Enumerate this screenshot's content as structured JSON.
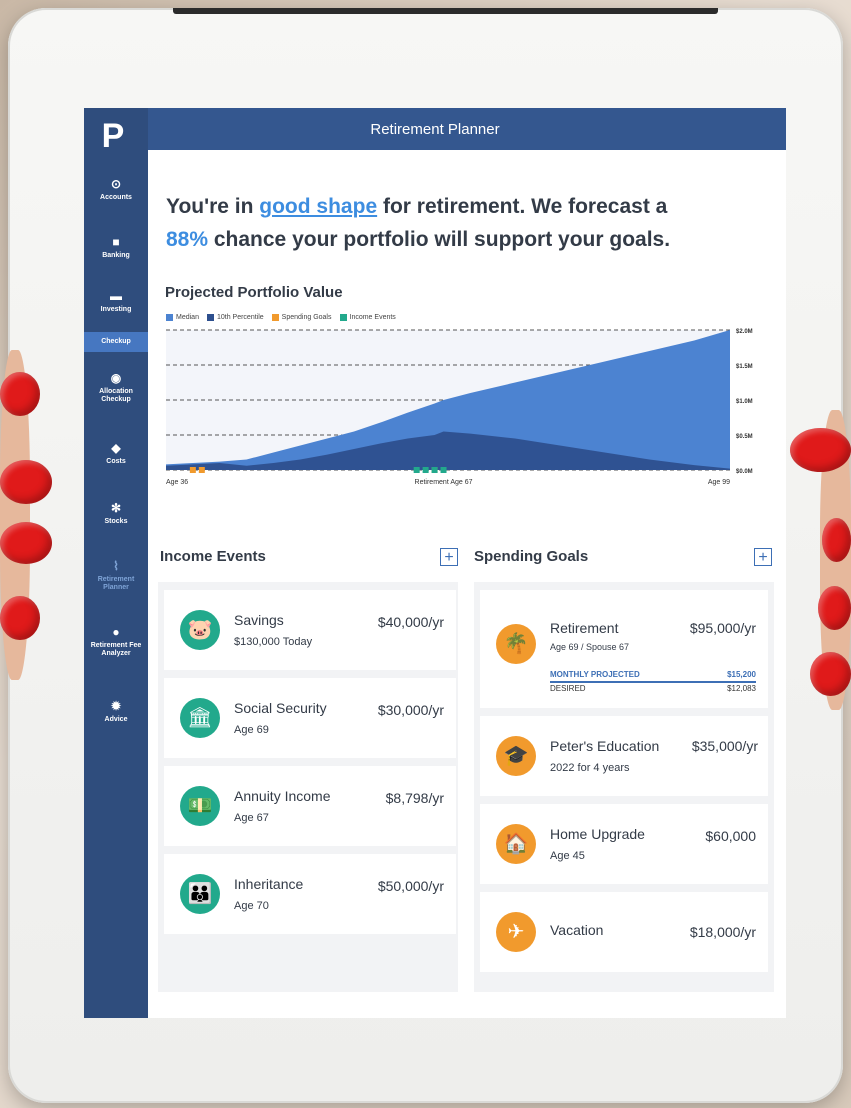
{
  "app": {
    "title": "Retirement Planner",
    "logo": "P"
  },
  "sidebar": {
    "items": [
      {
        "label": "Accounts",
        "icon": "dollar-icon"
      },
      {
        "label": "Banking",
        "icon": "wallet-icon"
      },
      {
        "label": "Investing",
        "icon": "folder-icon"
      },
      {
        "label": "Checkup",
        "icon": ""
      },
      {
        "label": "Allocation Checkup",
        "icon": "target-icon"
      },
      {
        "label": "Costs",
        "icon": "tag-icon"
      },
      {
        "label": "Stocks",
        "icon": "gear-icon"
      },
      {
        "label": "Retirement Planner",
        "icon": "palm-icon"
      },
      {
        "label": "Retirement Fee Analyzer",
        "icon": "piggy-icon"
      },
      {
        "label": "Advice",
        "icon": "sun-icon"
      }
    ]
  },
  "headline": {
    "prefix": "You're in ",
    "status": "good shape",
    "mid": " for retirement. We forecast a",
    "percent": "88%",
    "suffix": " chance your portfolio will support your goals."
  },
  "chart_data": {
    "type": "area",
    "title": "Projected Portfolio Value",
    "legend": [
      "Median",
      "10th Percentile",
      "Spending Goals",
      "Income Events"
    ],
    "legend_colors": [
      "#4c83d1",
      "#2d4f8e",
      "#f19a2d",
      "#22a98c"
    ],
    "x_ticks": [
      "Age 36",
      "Retirement Age 67",
      "Age 99"
    ],
    "y_ticks": [
      "$0.0M",
      "$0.5M",
      "$1.0M",
      "$1.5M",
      "$2.0M"
    ],
    "x": [
      36,
      39,
      42,
      45,
      48,
      51,
      54,
      57,
      60,
      63,
      66,
      67,
      70,
      75,
      80,
      85,
      90,
      95,
      99
    ],
    "series": [
      {
        "name": "Median",
        "values": [
          0.08,
          0.1,
          0.12,
          0.15,
          0.25,
          0.35,
          0.45,
          0.55,
          0.68,
          0.82,
          0.95,
          1.0,
          1.1,
          1.25,
          1.4,
          1.55,
          1.7,
          1.85,
          2.0
        ]
      },
      {
        "name": "10th Percentile",
        "values": [
          0.06,
          0.08,
          0.1,
          0.06,
          0.1,
          0.15,
          0.22,
          0.3,
          0.38,
          0.45,
          0.5,
          0.55,
          0.52,
          0.45,
          0.35,
          0.25,
          0.15,
          0.07,
          0.02
        ]
      }
    ],
    "spending_markers": [
      39,
      40,
      66
    ],
    "income_markers": [
      64,
      65,
      66,
      67
    ],
    "ylim": [
      0,
      2.0
    ],
    "grid": true
  },
  "income": {
    "title": "Income Events",
    "items": [
      {
        "name": "Savings",
        "sub": "$130,000 Today",
        "amount": "$40,000/yr",
        "icon": "piggy-bank-icon",
        "glyph": "🐷"
      },
      {
        "name": "Social Security",
        "sub": "Age 69",
        "amount": "$30,000/yr",
        "icon": "bank-icon",
        "glyph": "🏛"
      },
      {
        "name": "Annuity Income",
        "sub": "Age 67",
        "amount": "$8,798/yr",
        "icon": "cash-icon",
        "glyph": "💵"
      },
      {
        "name": "Inheritance",
        "sub": "Age 70",
        "amount": "$50,000/yr",
        "icon": "family-icon",
        "glyph": "👪"
      }
    ]
  },
  "spending": {
    "title": "Spending Goals",
    "items": [
      {
        "name": "Retirement",
        "sub": "Age 69 / Spouse 67",
        "amount": "$95,000/yr",
        "icon": "palm-tree-icon",
        "glyph": "🌴"
      },
      {
        "name": "Peter's Education",
        "sub": "2022 for 4 years",
        "amount": "$35,000/yr",
        "icon": "graduation-cap-icon",
        "glyph": "🎓"
      },
      {
        "name": "Home Upgrade",
        "sub": "Age 45",
        "amount": "$60,000",
        "icon": "house-icon",
        "glyph": "🏠"
      },
      {
        "name": "Vacation",
        "sub": "",
        "amount": "$18,000/yr",
        "icon": "airplane-icon",
        "glyph": "✈"
      }
    ],
    "monthly_label": "MONTHLY PROJECTED",
    "monthly_value": "$15,200",
    "desired_label": "DESIRED",
    "desired_value": "$12,083"
  }
}
